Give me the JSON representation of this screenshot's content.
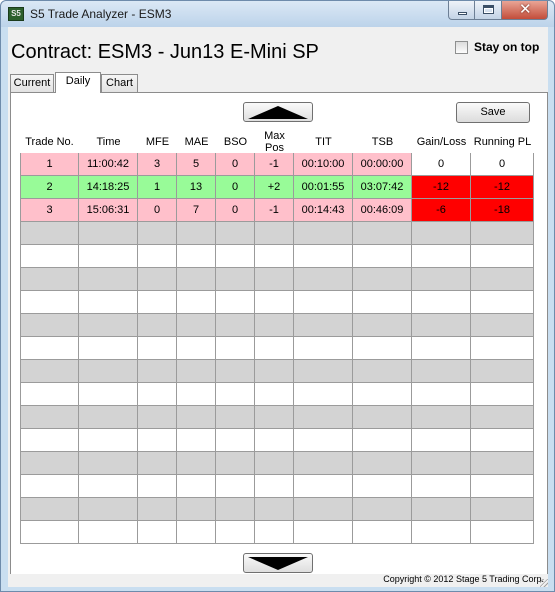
{
  "window": {
    "title": "S5 Trade Analyzer - ESM3",
    "icon": "S5",
    "controls": [
      "minimize-icon",
      "maximize-icon",
      "close-icon"
    ]
  },
  "contract": {
    "title": "Contract: ESM3 - Jun13 E-Mini SP"
  },
  "stay_on_top": {
    "label": "Stay on top",
    "checked": false
  },
  "tabs": [
    {
      "label": "Current",
      "active": false
    },
    {
      "label": "Daily",
      "active": true
    },
    {
      "label": "Chart",
      "active": false
    }
  ],
  "toolbar": {
    "save_label": "Save",
    "scroll_up_icon": "up-arrow-icon",
    "scroll_down_icon": "down-arrow-icon"
  },
  "table": {
    "headers": [
      "Trade No.",
      "Time",
      "MFE",
      "MAE",
      "BSO",
      "Max Pos",
      "TIT",
      "TSB",
      "Gain/Loss",
      "Running PL"
    ],
    "rows": [
      [
        "1",
        "11:00:42",
        "3",
        "5",
        "0",
        "-1",
        "00:10:00",
        "00:00:00",
        "0",
        "0"
      ],
      [
        "2",
        "14:18:25",
        "1",
        "13",
        "0",
        "+2",
        "00:01:55",
        "03:07:42",
        "-12",
        "-12"
      ],
      [
        "3",
        "15:06:31",
        "0",
        "7",
        "0",
        "-1",
        "00:14:43",
        "00:46:09",
        "-6",
        "-18"
      ]
    ],
    "row_colors": [
      "#ffc0cb",
      "#98fb98",
      "#ffc0cb"
    ],
    "pl_colors": [
      "#ffffff",
      "#ff0000",
      "#ff0000"
    ],
    "empty_row_count": 14
  },
  "footer": {
    "copyright": "Copyright © 2012 Stage 5 Trading Corp."
  }
}
